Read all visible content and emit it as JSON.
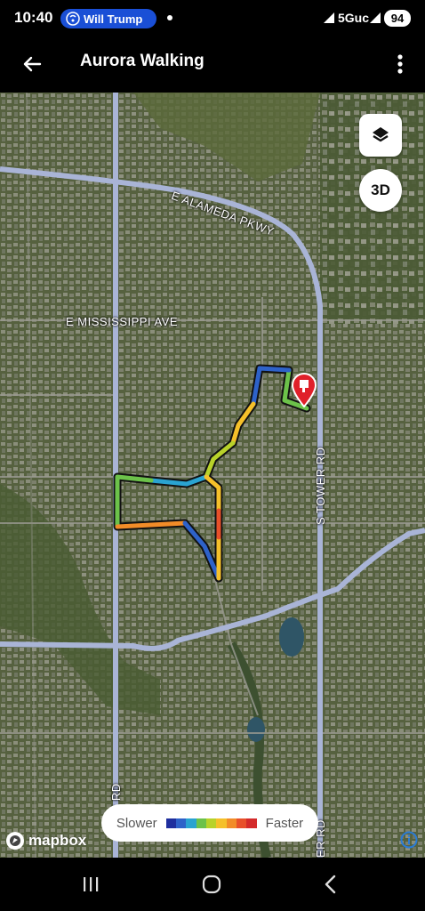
{
  "status": {
    "time": "10:40",
    "call_pill_text": "Will Trump",
    "network": "5Guc",
    "battery": "94"
  },
  "app_bar": {
    "title": "Aurora Walking"
  },
  "map": {
    "streets": {
      "alameda": "E ALAMEDA PKWY",
      "mississippi": "E MISSISSIPPI AVE",
      "tower": "S TOWER RD",
      "left_bottom": "UC RD",
      "right_bottom": "ER RD"
    },
    "three_d_label": "3D",
    "attribution": "mapbox"
  },
  "legend": {
    "slower_label": "Slower",
    "faster_label": "Faster",
    "colors": [
      "#1f2f9e",
      "#2e62c9",
      "#2aa3d1",
      "#6cc24a",
      "#b8d22a",
      "#f5c02a",
      "#f28c28",
      "#e8502a",
      "#d42a2a"
    ]
  },
  "nav": {
    "recent": "recent-apps-icon",
    "home": "home-icon",
    "back": "back-icon"
  }
}
